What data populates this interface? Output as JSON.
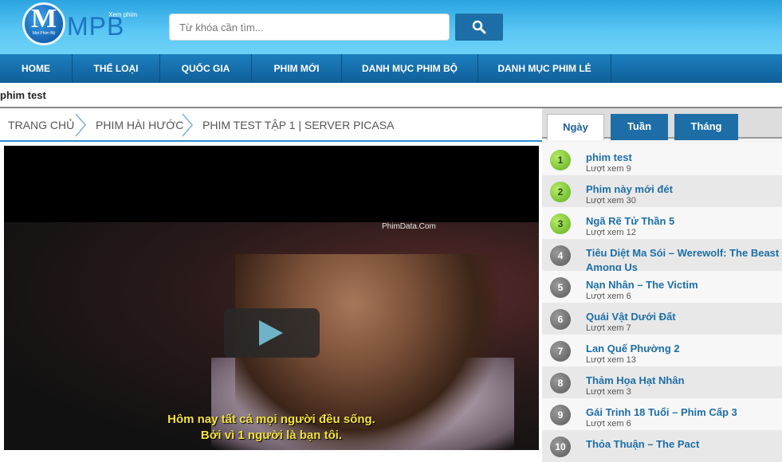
{
  "header": {
    "logo_text": "MPB",
    "logo_letter": "M",
    "logo_small": "Mọt Phim Bộ",
    "logo_sub": "Xem phim",
    "search_placeholder": "Từ khóa cần tìm...",
    "search_icon": "search-icon"
  },
  "nav": {
    "items": [
      {
        "label": "HOME"
      },
      {
        "label": "THỂ LOẠI"
      },
      {
        "label": "QUỐC GIA"
      },
      {
        "label": "PHIM MỚI"
      },
      {
        "label": "DANH MỤC PHIM BỘ"
      },
      {
        "label": "DANH MỤC PHIM LẺ"
      }
    ]
  },
  "page": {
    "title": "phim test"
  },
  "breadcrumb": {
    "items": [
      {
        "label": "TRANG CHỦ"
      },
      {
        "label": "PHIM HÀI HƯỚC"
      },
      {
        "label": "PHIM TEST TẬP 1 | SERVER PICASA"
      }
    ]
  },
  "player": {
    "watermark": "PhimData.Com",
    "subtitle_line1": "Hôm nay tất cả mọi người đều sống.",
    "subtitle_line2": "Bởi vì 1 người là bạn tôi.",
    "play_icon": "play-icon"
  },
  "sidebar": {
    "tabs": [
      {
        "label": "Ngày"
      },
      {
        "label": "Tuần"
      },
      {
        "label": "Tháng"
      }
    ],
    "views_label": "Lượt xem",
    "ranking": [
      {
        "rank": "1",
        "title": "phim test",
        "views": "Lượt xem 9"
      },
      {
        "rank": "2",
        "title": "Phim này mới đét",
        "views": "Lượt xem 30"
      },
      {
        "rank": "3",
        "title": "Ngã Rẽ Tử Thần 5",
        "views": "Lượt xem 12"
      },
      {
        "rank": "4",
        "title": "Tiêu Diệt Ma Sói – Werewolf: The Beast Among Us",
        "views": ""
      },
      {
        "rank": "5",
        "title": "Nạn Nhân – The Victim",
        "views": "Lượt xem 6"
      },
      {
        "rank": "6",
        "title": "Quái Vật Dưới Đất",
        "views": "Lượt xem 7"
      },
      {
        "rank": "7",
        "title": "Lan Quế Phường 2",
        "views": "Lượt xem 13"
      },
      {
        "rank": "8",
        "title": "Thảm Họa Hạt Nhân",
        "views": "Lượt xem 3"
      },
      {
        "rank": "9",
        "title": "Gái Trinh 18 Tuổi – Phim Cấp 3",
        "views": "Lượt xem 6"
      },
      {
        "rank": "10",
        "title": "Thỏa Thuận – The Pact",
        "views": ""
      }
    ]
  }
}
